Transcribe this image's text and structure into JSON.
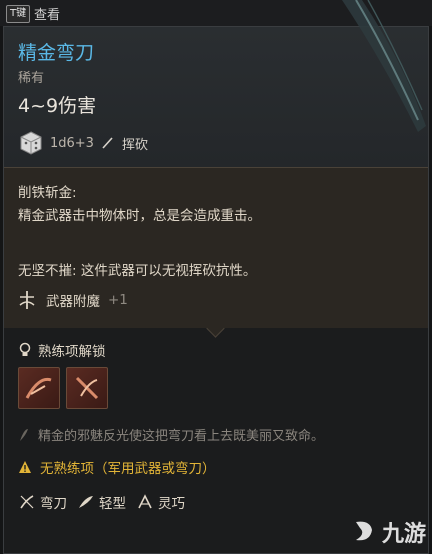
{
  "topbar": {
    "key_hint": "T键",
    "label": "查看"
  },
  "item": {
    "name": "精金弯刀",
    "rarity": "稀有",
    "damage": "4~9伤害",
    "dice": "1d6+3",
    "damage_type": "挥砍"
  },
  "ability": {
    "title": "削铁斩金:",
    "body": "精金武器击中物体时，总是会造成重击。",
    "passive": "无坚不摧: 这件武器可以无视挥砍抗性。"
  },
  "enchant": {
    "label": "武器附魔",
    "value": "+1"
  },
  "proficiency": {
    "title": "熟练项解锁",
    "flavor": "精金的邪魅反光使这把弯刀看上去既美丽又致命。",
    "warning": "无熟练项（军用武器或弯刀）"
  },
  "tags": [
    {
      "icon": "scimitar-icon",
      "label": "弯刀"
    },
    {
      "icon": "feather-icon",
      "label": "轻型"
    },
    {
      "icon": "finesse-icon",
      "label": "灵巧"
    }
  ],
  "watermark": {
    "text": "九游"
  },
  "colors": {
    "name": "#5ab8e6",
    "warning": "#e2b437",
    "panel": "#1f2123"
  }
}
